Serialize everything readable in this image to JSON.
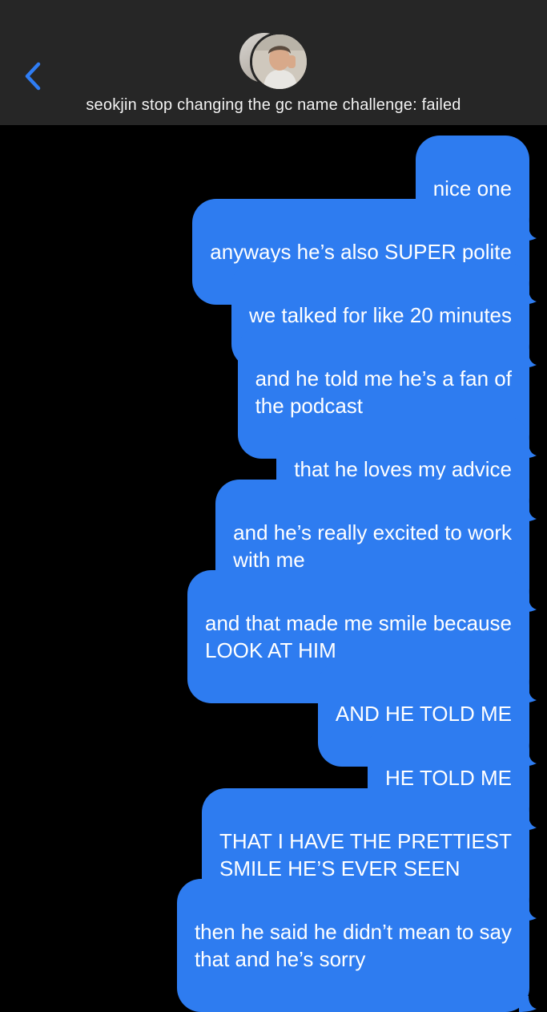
{
  "header": {
    "group_name": "seokjin stop changing the gc name challenge: failed",
    "back_icon": "chevron-left-icon",
    "accent_color": "#2f7df4"
  },
  "theme": {
    "bubble_color": "#2e7cf0",
    "background": "#000000",
    "header_background": "#262626"
  },
  "messages": [
    {
      "text": "nice one"
    },
    {
      "text": "anyways he’s also SUPER polite"
    },
    {
      "text": "we talked for like 20 minutes"
    },
    {
      "text": "and he told me he’s a fan of\nthe podcast"
    },
    {
      "text": "that he loves my advice"
    },
    {
      "text": "and he’s really excited to work\nwith me"
    },
    {
      "text": "and that made me smile because\nLOOK AT HIM"
    },
    {
      "text": "AND HE TOLD ME"
    },
    {
      "text": "HE TOLD ME"
    },
    {
      "text": "THAT I HAVE THE PRETTIEST\nSMILE HE’S EVER SEEN"
    },
    {
      "text": "then he said he didn’t mean to say\nthat and he’s sorry"
    }
  ]
}
